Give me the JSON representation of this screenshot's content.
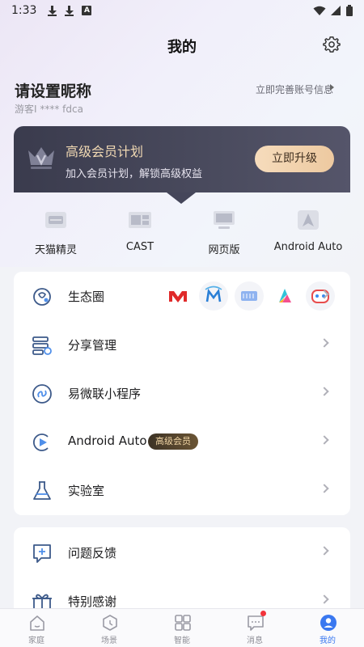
{
  "status_bar": {
    "time": "1:33"
  },
  "header": {
    "title": "我的",
    "settings_icon": "gear-icon"
  },
  "profile": {
    "nickname": "请设置昵称",
    "guest_id": "游客I ****  fdca",
    "complete_link": "立即完善账号信息"
  },
  "vip": {
    "title": "高级会员计划",
    "subtitle": "加入会员计划，解锁高级权益",
    "button": "立即升级",
    "title_color": "#f1d9b3",
    "button_color": "#f6dcbc"
  },
  "quick_links": [
    {
      "label": "天猫精灵",
      "icon": "tmall-genie-icon"
    },
    {
      "label": "CAST",
      "icon": "cast-icon"
    },
    {
      "label": "网页版",
      "icon": "web-monitor-icon"
    },
    {
      "label": "Android Auto",
      "icon": "android-auto-icon"
    }
  ],
  "menu": [
    {
      "label": "生态圈",
      "icon": "ecosystem-icon"
    },
    {
      "label": "分享管理",
      "icon": "share-manage-icon"
    },
    {
      "label": "易微联小程序",
      "icon": "mini-program-icon"
    },
    {
      "label": "Android Auto",
      "icon": "android-auto-play-icon",
      "badge": "高级会员"
    },
    {
      "label": "实验室",
      "icon": "flask-icon"
    }
  ],
  "menu2": [
    {
      "label": "问题反馈",
      "icon": "feedback-icon"
    },
    {
      "label": "特别感谢",
      "icon": "gift-icon"
    }
  ],
  "ecosystem_icons": [
    "meross-icon",
    "m-brand-icon",
    "speaker-icon",
    "a-brand-icon",
    "robot-icon"
  ],
  "tabs": [
    {
      "label": "家庭",
      "icon": "home-icon"
    },
    {
      "label": "场景",
      "icon": "scene-icon"
    },
    {
      "label": "智能",
      "icon": "smart-grid-icon"
    },
    {
      "label": "消息",
      "icon": "message-icon"
    },
    {
      "label": "我的",
      "icon": "profile-icon",
      "active": true
    }
  ],
  "colors": {
    "accent": "#3a78f0",
    "unread_dot": "#f2333a"
  }
}
